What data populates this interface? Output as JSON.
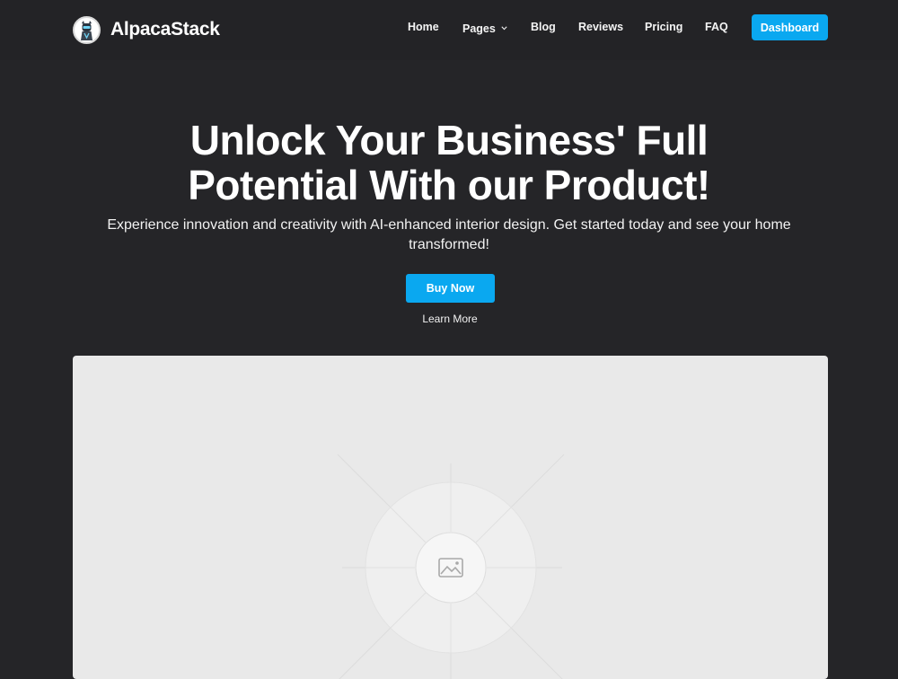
{
  "brand": {
    "name": "AlpacaStack",
    "logo_icon": "alpaca-logo-icon"
  },
  "nav": {
    "items": [
      {
        "label": "Home"
      },
      {
        "label": "Pages",
        "has_dropdown": true
      },
      {
        "label": "Blog"
      },
      {
        "label": "Reviews"
      },
      {
        "label": "Pricing"
      },
      {
        "label": "FAQ"
      }
    ],
    "cta_label": "Dashboard"
  },
  "hero": {
    "title_line1": "Unlock Your Business' Full",
    "title_line2": "Potential With our Product!",
    "subtitle": "Experience innovation and creativity with AI-enhanced interior design. Get started today and see your home transformed!",
    "primary_button": "Buy Now",
    "secondary_link": "Learn More"
  },
  "media": {
    "placeholder_icon": "image-placeholder-icon"
  },
  "colors": {
    "background": "#252528",
    "navbar": "#232326",
    "accent": "#0aa8f0",
    "text": "#ffffff",
    "placeholder_bg": "#e9e9e9"
  }
}
